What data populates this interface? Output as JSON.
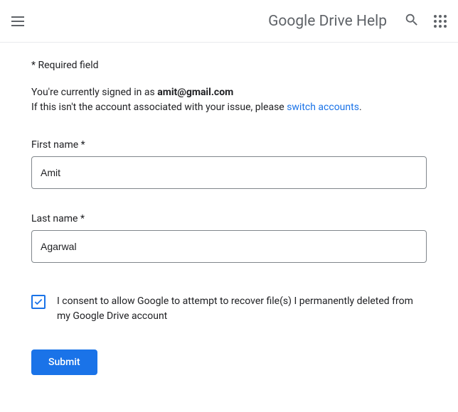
{
  "header": {
    "title": "Google Drive Help"
  },
  "form": {
    "required_note": "* Required field",
    "signin_prefix": "You're currently signed in as ",
    "signin_email": "amit@gmail.com",
    "signin_wrongaccount": "If this isn't the account associated with your issue, please ",
    "switch_link": "switch accounts",
    "signin_period": ".",
    "first_name_label": "First name *",
    "first_name_value": "Amit",
    "last_name_label": "Last name *",
    "last_name_value": "Agarwal",
    "consent_label": "I consent to allow Google to attempt to recover file(s) I permanently deleted from my Google Drive account",
    "submit_label": "Submit"
  }
}
